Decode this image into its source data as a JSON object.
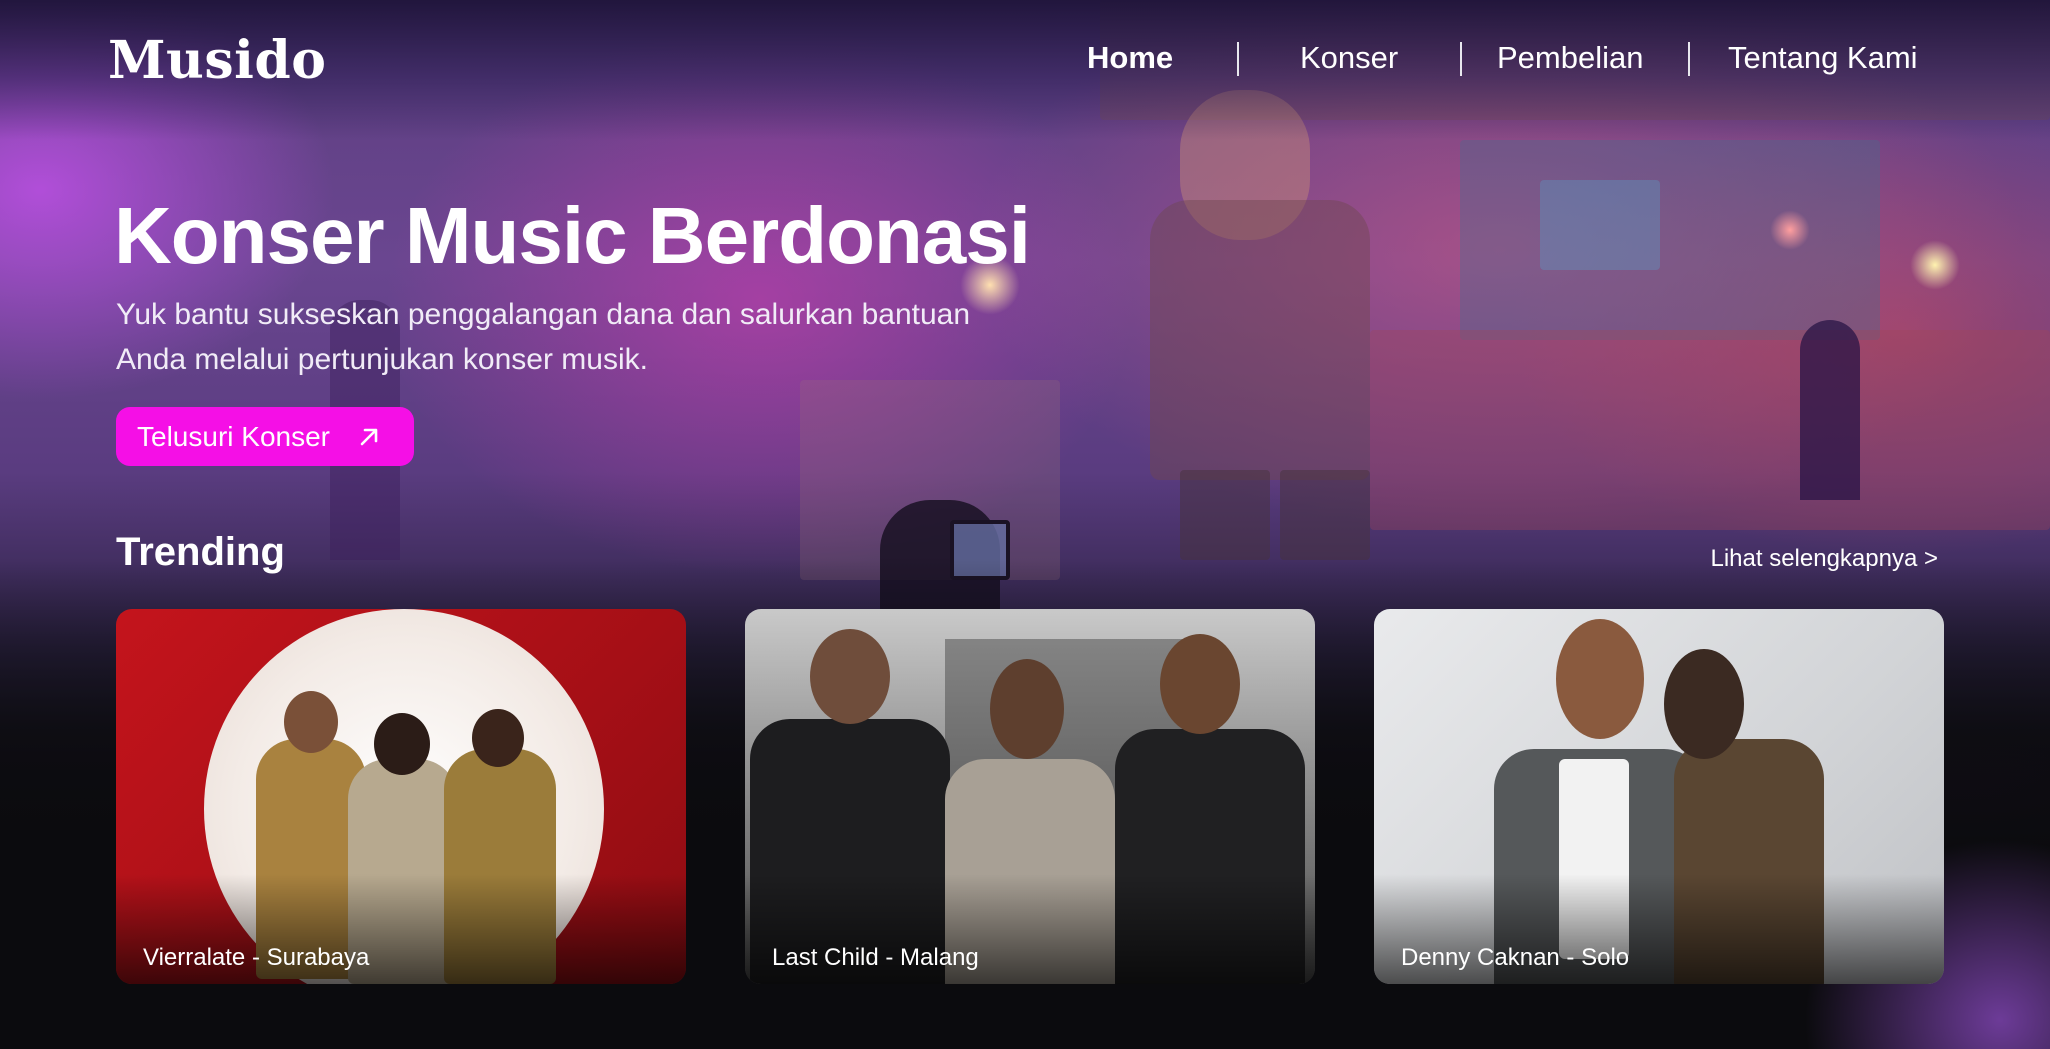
{
  "brand": {
    "logo": "Musido"
  },
  "nav": {
    "items": [
      {
        "label": "Home",
        "active": true
      },
      {
        "label": "Konser",
        "active": false
      },
      {
        "label": "Pembelian",
        "active": false
      },
      {
        "label": "Tentang Kami",
        "active": false
      }
    ]
  },
  "hero": {
    "title": "Konser Music Berdonasi",
    "subtitle_line1": "Yuk bantu sukseskan penggalangan dana dan salurkan bantuan",
    "subtitle_line2": "Anda melalui pertunjukan konser musik.",
    "cta_label": "Telusuri Konser",
    "cta_icon": "arrow-up-right-icon"
  },
  "trending": {
    "title": "Trending",
    "see_more": "Lihat selengkapnya >",
    "cards": [
      {
        "label": "Vierralate - Surabaya"
      },
      {
        "label": "Last Child - Malang"
      },
      {
        "label": "Denny Caknan - Solo"
      }
    ]
  },
  "colors": {
    "accent": "#f50fe6",
    "background": "#0b0b0e",
    "hero_purple": "#6a4690"
  }
}
